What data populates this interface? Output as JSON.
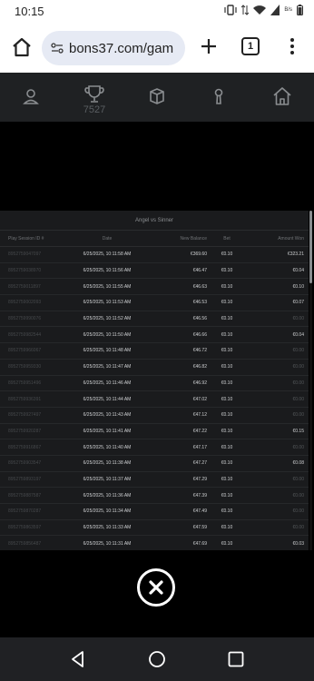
{
  "status": {
    "time": "10:15",
    "battery_label": "89",
    "net_label": "B/s"
  },
  "browser": {
    "url": "bons37.com/gam",
    "tab_count": "1"
  },
  "game_nav": {
    "trophy_count": "7527"
  },
  "table": {
    "title": "Angel vs Sinner",
    "headers": [
      "Play Session ID #",
      "Date",
      "New Balance",
      "Bet",
      "Amount Won"
    ],
    "rows": [
      [
        "8952759047097",
        "6/25/2025, 10:11:58 AM",
        "€369.60",
        "€0.10",
        "€323.21"
      ],
      [
        "8952759038970",
        "6/25/2025, 10:11:56 AM",
        "€46.47",
        "€0.10",
        "€0.04"
      ],
      [
        "8952759011897",
        "6/25/2025, 10:11:55 AM",
        "€46.63",
        "€0.10",
        "€0.10"
      ],
      [
        "8952759002093",
        "6/25/2025, 10:11:53 AM",
        "€46.53",
        "€0.10",
        "€0.07"
      ],
      [
        "8952759990076",
        "6/25/2025, 10:11:52 AM",
        "€46.56",
        "€0.10",
        "€0.00"
      ],
      [
        "8952759982544",
        "6/25/2025, 10:11:50 AM",
        "€46.66",
        "€0.10",
        "€0.04"
      ],
      [
        "8952759966067",
        "6/25/2025, 10:11:48 AM",
        "€46.72",
        "€0.10",
        "€0.00"
      ],
      [
        "8952759959330",
        "6/25/2025, 10:11:47 AM",
        "€46.82",
        "€0.10",
        "€0.00"
      ],
      [
        "8952759951496",
        "6/25/2025, 10:11:46 AM",
        "€46.92",
        "€0.10",
        "€0.00"
      ],
      [
        "8952759936391",
        "6/25/2025, 10:11:44 AM",
        "€47.02",
        "€0.10",
        "€0.00"
      ],
      [
        "8952759927497",
        "6/25/2025, 10:11:43 AM",
        "€47.12",
        "€0.10",
        "€0.00"
      ],
      [
        "8952759920287",
        "6/25/2025, 10:11:41 AM",
        "€47.22",
        "€0.10",
        "€0.15"
      ],
      [
        "8952759916867",
        "6/25/2025, 10:11:40 AM",
        "€47.17",
        "€0.10",
        "€0.00"
      ],
      [
        "8952759903547",
        "6/25/2025, 10:11:38 AM",
        "€47.27",
        "€0.10",
        "€0.08"
      ],
      [
        "8952759893197",
        "6/25/2025, 10:11:37 AM",
        "€47.29",
        "€0.10",
        "€0.00"
      ],
      [
        "8952759887587",
        "6/25/2025, 10:11:36 AM",
        "€47.39",
        "€0.10",
        "€0.00"
      ],
      [
        "8952759870287",
        "6/25/2025, 10:11:34 AM",
        "€47.49",
        "€0.10",
        "€0.00"
      ],
      [
        "8952759863597",
        "6/25/2025, 10:11:33 AM",
        "€47.59",
        "€0.10",
        "€0.00"
      ],
      [
        "8952759856487",
        "6/25/2025, 10:11:31 AM",
        "€47.69",
        "€0.10",
        "€0.03"
      ]
    ]
  }
}
